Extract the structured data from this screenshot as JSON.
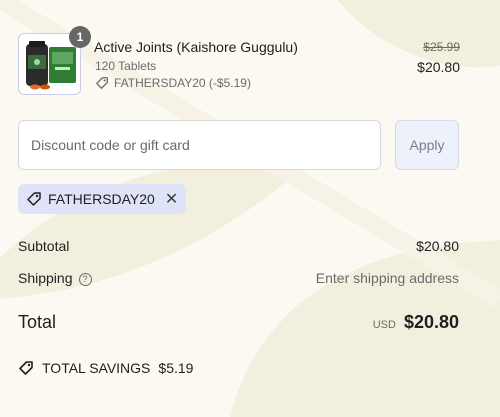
{
  "product": {
    "quantity": "1",
    "name": "Active Joints (Kaishore Guggulu)",
    "variant": "120 Tablets",
    "discount_text": "FATHERSDAY20 (-$5.19)",
    "original_price": "$25.99",
    "price": "$20.80",
    "thumbnail_icon": "supplement-bottle-image"
  },
  "discount": {
    "placeholder": "Discount code or gift card",
    "apply_label": "Apply"
  },
  "applied_code": {
    "code": "FATHERSDAY20",
    "remove_icon": "close-icon"
  },
  "summary": {
    "subtotal_label": "Subtotal",
    "subtotal_value": "$20.80",
    "shipping_label": "Shipping",
    "shipping_value": "Enter shipping address",
    "total_label": "Total",
    "currency": "USD",
    "total_value": "$20.80",
    "savings_label": "TOTAL SAVINGS",
    "savings_value": "$5.19"
  },
  "colors": {
    "background": "#fbf9f1",
    "chip_background": "#dfe3f7",
    "apply_background": "#eef0fa"
  }
}
